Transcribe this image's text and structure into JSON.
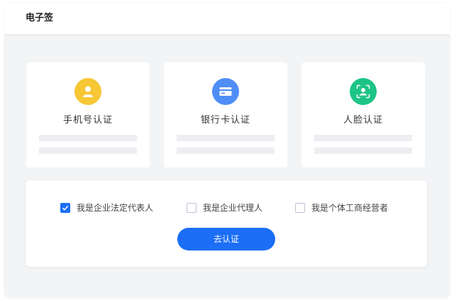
{
  "header": {
    "title": "电子签"
  },
  "cards": [
    {
      "label": "手机号认证",
      "icon": "user-badge-icon",
      "color": "#f7c736"
    },
    {
      "label": "银行卡认证",
      "icon": "bank-card-icon",
      "color": "#4f8ef7"
    },
    {
      "label": "人脸认证",
      "icon": "face-scan-icon",
      "color": "#1dc486"
    }
  ],
  "options": [
    {
      "label": "我是企业法定代表人",
      "checked": true
    },
    {
      "label": "我是企业代理人",
      "checked": false
    },
    {
      "label": "我是个体工商经营者",
      "checked": false
    }
  ],
  "submit": {
    "label": "去认证"
  },
  "colors": {
    "accent": "#1b6ef5",
    "background": "#f3f4f6"
  }
}
